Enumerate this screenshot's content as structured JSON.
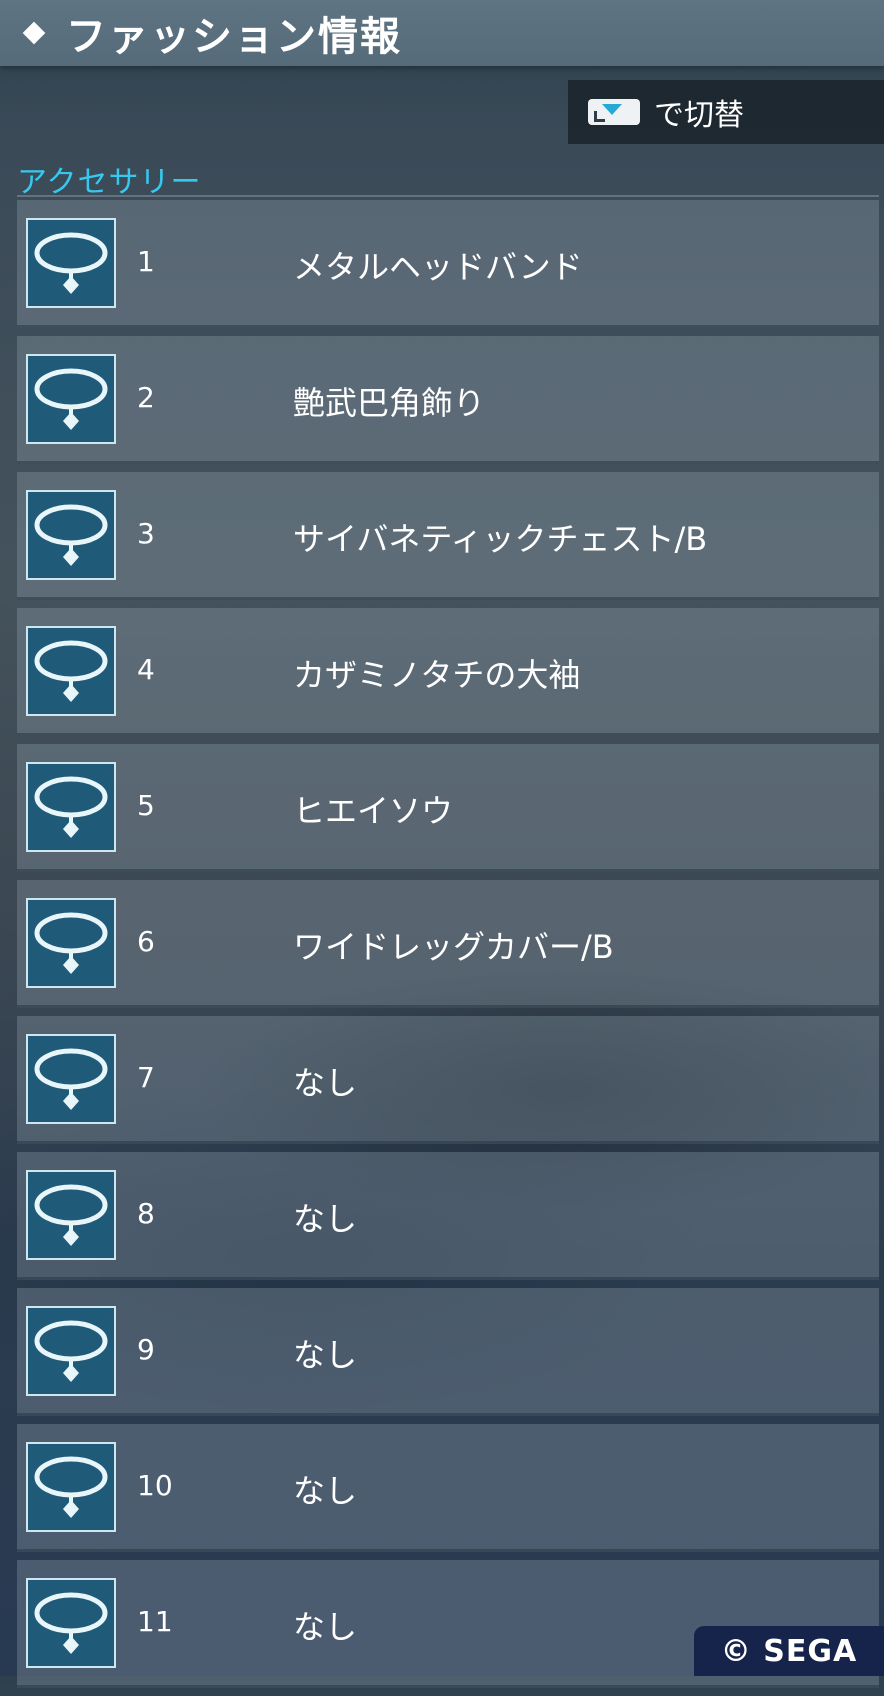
{
  "header": {
    "title": "ファッション情報"
  },
  "switch": {
    "label": "で切替"
  },
  "section": {
    "title": "アクセサリー"
  },
  "items": [
    {
      "num": "1",
      "name": "メタルヘッドバンド"
    },
    {
      "num": "2",
      "name": "艶武巴角飾り"
    },
    {
      "num": "3",
      "name": "サイバネティックチェスト/B"
    },
    {
      "num": "4",
      "name": "カザミノタチの大袖"
    },
    {
      "num": "5",
      "name": "ヒエイソウ"
    },
    {
      "num": "6",
      "name": "ワイドレッグカバー/B"
    },
    {
      "num": "7",
      "name": "なし"
    },
    {
      "num": "8",
      "name": "なし"
    },
    {
      "num": "9",
      "name": "なし"
    },
    {
      "num": "10",
      "name": "なし"
    },
    {
      "num": "11",
      "name": "なし"
    }
  ],
  "icons": {
    "item_icon": "accessory-necklace-icon",
    "switch_icon": "controller-button-icon"
  },
  "colors": {
    "accent": "#37c8ef",
    "icon_bg": "#1f5a79",
    "header_bg": "#5e7482"
  },
  "copyright": "© SEGA"
}
